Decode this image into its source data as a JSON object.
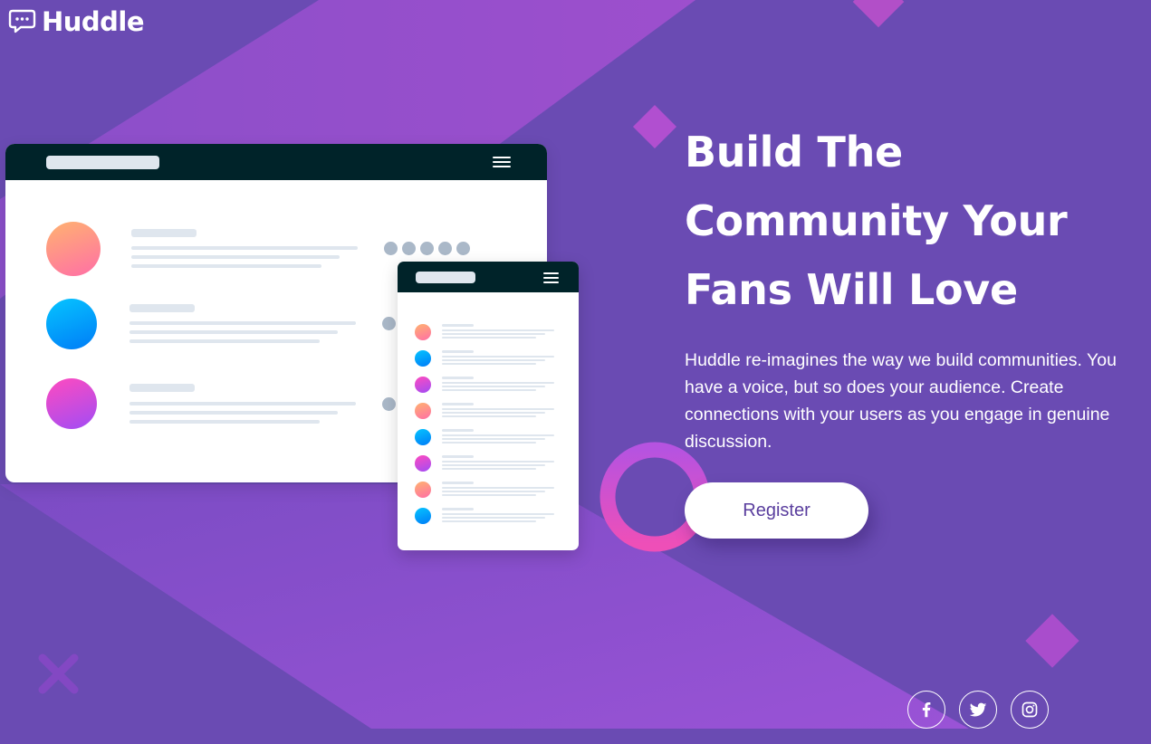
{
  "brand": {
    "name": "Huddle"
  },
  "hero": {
    "heading_line1": "Build The",
    "heading_line2": "Community Your",
    "heading_line3": "Fans Will Love",
    "description": "Huddle re-imagines the way we build communities. You have a voice, but so does your audience. Create connections with your users as you engage in genuine discussion.",
    "cta_label": "Register"
  },
  "illustration": {
    "desktop_rows": [
      "orange",
      "blue",
      "pink"
    ],
    "mobile_rows": [
      "orange",
      "blue",
      "pink",
      "orange",
      "blue",
      "pink",
      "orange",
      "blue"
    ]
  },
  "socials": [
    {
      "icon": "facebook-icon"
    },
    {
      "icon": "twitter-icon"
    },
    {
      "icon": "instagram-icon"
    }
  ],
  "colors": {
    "background": "#6a4bb3",
    "accent_violet": "#5a3e9e",
    "header_dark": "#002329",
    "ring_pink": "#e14fc9"
  }
}
